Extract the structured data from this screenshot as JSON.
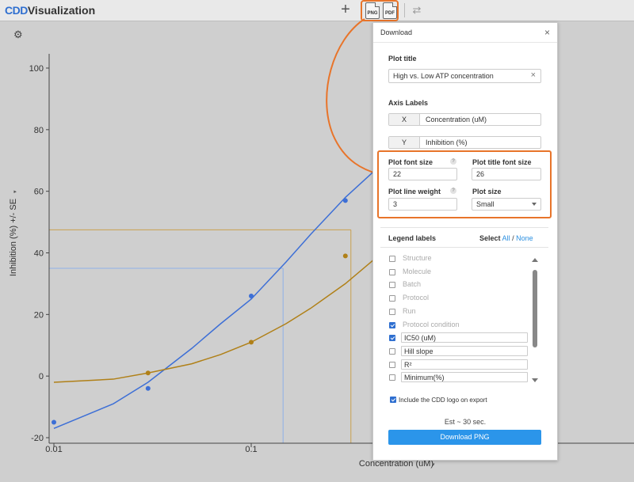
{
  "app": {
    "logo_mark": "CDD",
    "logo_text": "Visualization"
  },
  "toolbar": {
    "add_label": "+",
    "png_label": "PNG",
    "pdf_label": "PDF",
    "swap_label": "⇄"
  },
  "chart_data": {
    "type": "scatter",
    "xscale": "log",
    "xlim": [
      0.01,
      1.5
    ],
    "ylim": [
      -20,
      105
    ],
    "yticks": [
      100,
      80,
      60,
      40,
      20,
      0,
      -20
    ],
    "xticks": [
      0.01,
      0.1
    ],
    "xtick_labels": [
      "0.01",
      "0.1"
    ],
    "xlabel": "Concentration (uM)",
    "ylabel": "Inhibition (%) +/- SE",
    "series": [
      {
        "color": "#3d6fd6",
        "x": [
          0.01,
          0.03,
          0.1,
          0.3
        ],
        "y": [
          -15,
          -4,
          26,
          57
        ]
      },
      {
        "color": "#b08018",
        "x": [
          0.03,
          0.1,
          0.3
        ],
        "y": [
          1,
          11,
          39
        ]
      }
    ],
    "curves": [
      {
        "color": "#3d6fd6",
        "x": [
          0.01,
          0.02,
          0.03,
          0.05,
          0.07,
          0.1,
          0.15,
          0.2,
          0.3,
          0.5,
          1,
          1.5
        ],
        "y": [
          -17,
          -9,
          -2,
          9,
          17,
          25,
          37,
          46,
          58,
          71,
          88,
          94
        ]
      },
      {
        "color": "#b08018",
        "x": [
          0.01,
          0.02,
          0.03,
          0.05,
          0.07,
          0.1,
          0.15,
          0.2,
          0.3,
          0.5,
          1,
          1.5
        ],
        "y": [
          -2,
          -1,
          1,
          4,
          7,
          11,
          17,
          22,
          30,
          42,
          58,
          66
        ]
      }
    ],
    "guides": [
      {
        "color": "#8fb0e8",
        "y": 35,
        "x": 0.145
      },
      {
        "color": "#c9a04e",
        "y": 47.5,
        "x": 0.32
      }
    ]
  },
  "download": {
    "title": "Download",
    "close": "×",
    "plot_title_label": "Plot title",
    "plot_title_value": "High vs. Low ATP concentration",
    "clear": "×",
    "axis_labels_label": "Axis Labels",
    "x_prefix": "X",
    "x_value": "Concentration (uM)",
    "y_prefix": "Y",
    "y_value": "Inhibition (%)",
    "font_size_label": "Plot font size",
    "font_size_value": "22",
    "title_font_size_label": "Plot title font size",
    "title_font_size_value": "26",
    "line_weight_label": "Plot line weight",
    "line_weight_value": "3",
    "plot_size_label": "Plot size",
    "plot_size_value": "Small",
    "help": "?",
    "legend_labels_label": "Legend labels",
    "select_label": "Select",
    "select_all": "All",
    "select_sep": "/",
    "select_none": "None",
    "legend_items": [
      {
        "label": "Structure",
        "checked": false,
        "editable": false
      },
      {
        "label": "Molecule",
        "checked": false,
        "editable": false
      },
      {
        "label": "Batch",
        "checked": false,
        "editable": false
      },
      {
        "label": "Protocol",
        "checked": false,
        "editable": false
      },
      {
        "label": "Run",
        "checked": false,
        "editable": false
      },
      {
        "label": "Protocol condition",
        "checked": true,
        "editable": false
      },
      {
        "label": "IC50 (uM)",
        "checked": true,
        "editable": true
      },
      {
        "label": "Hill slope",
        "checked": false,
        "editable": true
      },
      {
        "label": "R²",
        "checked": false,
        "editable": true
      },
      {
        "label": "Minimum(%)",
        "checked": false,
        "editable": true
      }
    ],
    "include_logo_label": "Include the CDD logo on export",
    "estimate": "Est ~ 30 sec.",
    "download_button": "Download PNG"
  }
}
